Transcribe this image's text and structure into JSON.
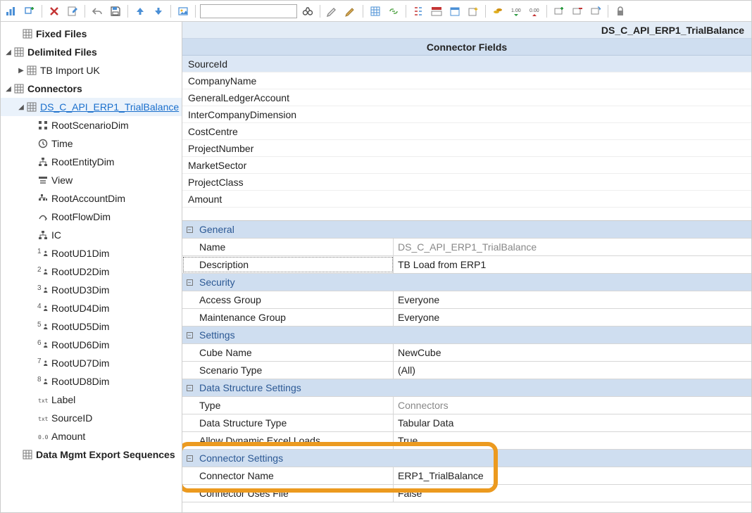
{
  "toolbar": {
    "search_value": ""
  },
  "tree": {
    "fixed_files": "Fixed Files",
    "delimited_files": "Delimited Files",
    "tb_import": "TB Import UK",
    "connectors": "Connectors",
    "ds_node": "DS_C_API_ERP1_TrialBalance",
    "children": [
      "RootScenarioDim",
      "Time",
      "RootEntityDim",
      "View",
      "RootAccountDim",
      "RootFlowDim",
      "IC",
      "RootUD1Dim",
      "RootUD2Dim",
      "RootUD3Dim",
      "RootUD4Dim",
      "RootUD5Dim",
      "RootUD6Dim",
      "RootUD7Dim",
      "RootUD8Dim",
      "Label",
      "SourceID",
      "Amount"
    ],
    "data_mgmt": "Data Mgmt Export Sequences"
  },
  "right": {
    "title": "DS_C_API_ERP1_TrialBalance",
    "subtitle": "Connector Fields",
    "fields": [
      "SourceId",
      "CompanyName",
      "GeneralLedgerAccount",
      "InterCompanyDimension",
      "CostCentre",
      "ProjectNumber",
      "MarketSector",
      "ProjectClass",
      "Amount"
    ]
  },
  "props": {
    "general": {
      "title": "General",
      "name_label": "Name",
      "name_value": "DS_C_API_ERP1_TrialBalance",
      "desc_label": "Description",
      "desc_value": "TB Load from ERP1"
    },
    "security": {
      "title": "Security",
      "access_label": "Access Group",
      "access_value": "Everyone",
      "maint_label": "Maintenance Group",
      "maint_value": "Everyone"
    },
    "settings": {
      "title": "Settings",
      "cube_label": "Cube Name",
      "cube_value": "NewCube",
      "scen_label": "Scenario Type",
      "scen_value": "(All)"
    },
    "dss": {
      "title": "Data Structure Settings",
      "type_label": "Type",
      "type_value": "Connectors",
      "dst_label": "Data Structure Type",
      "dst_value": "Tabular Data",
      "adel_label": "Allow Dynamic Excel Loads",
      "adel_value": "True"
    },
    "conn": {
      "title": "Connector Settings",
      "name_label": "Connector Name",
      "name_value": "ERP1_TrialBalance",
      "uses_label": "Connector Uses File",
      "uses_value": "False"
    }
  }
}
